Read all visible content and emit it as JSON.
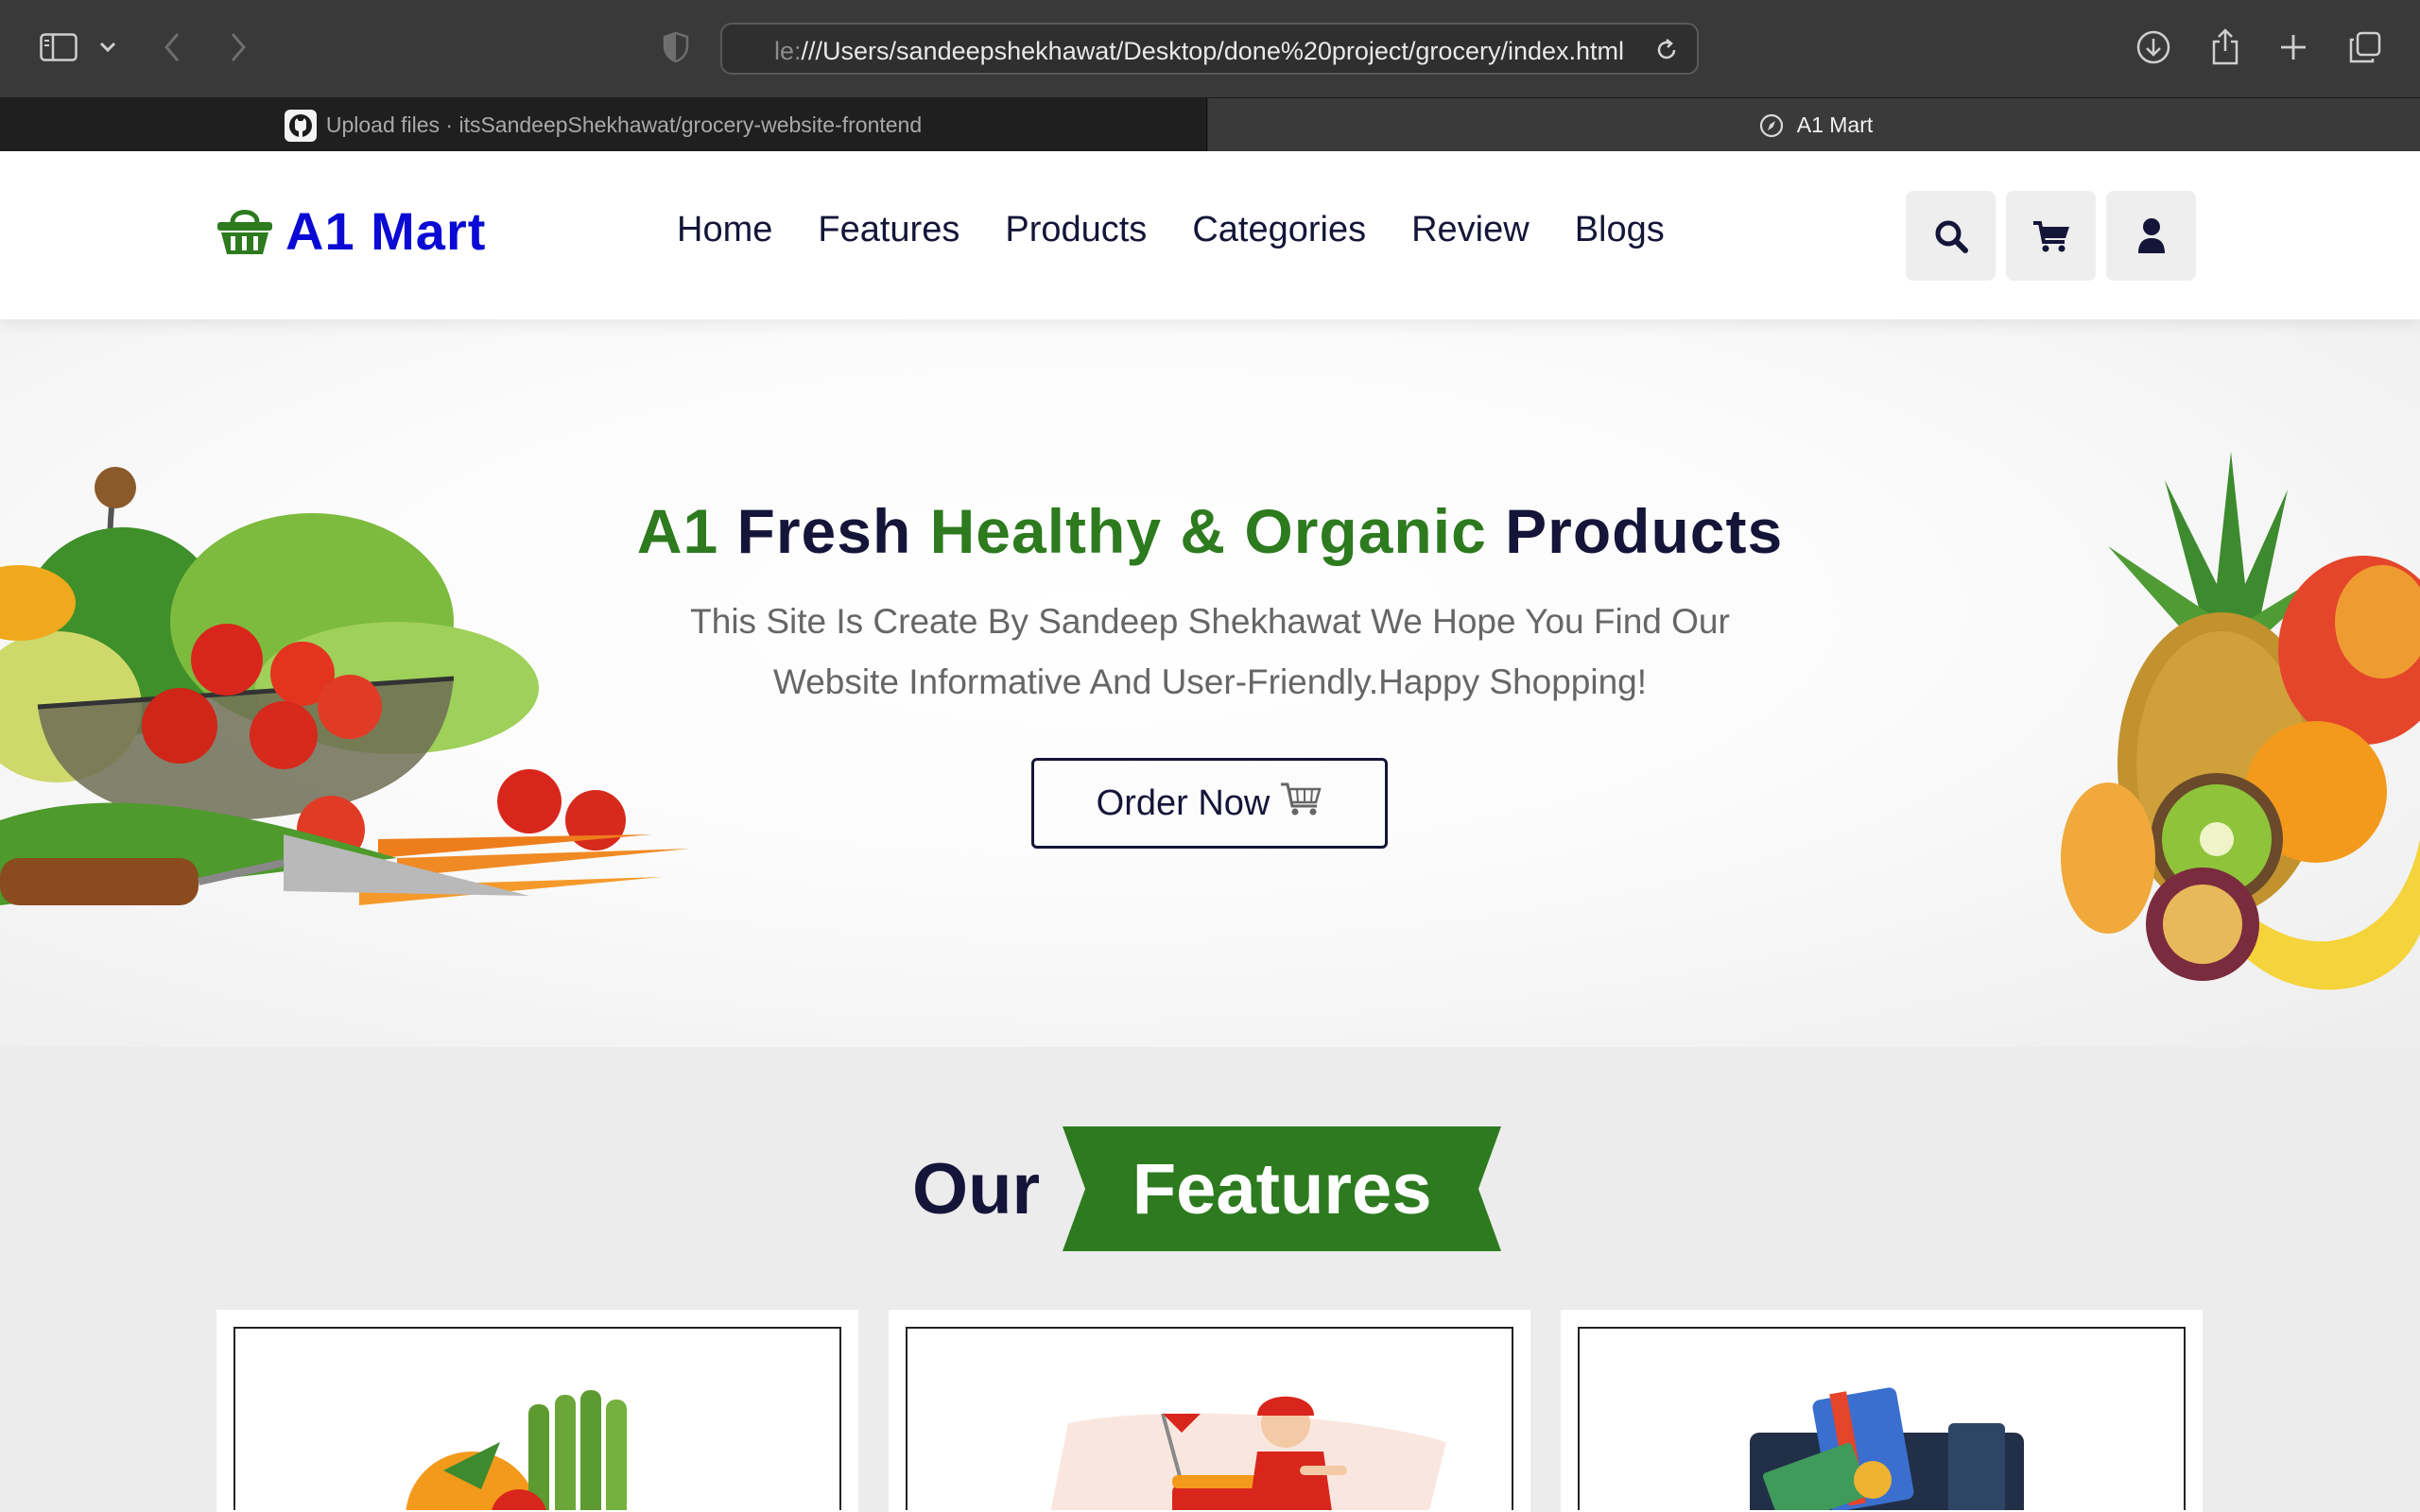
{
  "browser": {
    "url_prefix": "le:",
    "url_main": "///Users/sandeepshekhawat/Desktop/done%20project/grocery/index.html",
    "tabs": [
      {
        "title": "Upload files · itsSandeepShekhawat/grocery-website-frontend",
        "icon": "github-icon",
        "active": false
      },
      {
        "title": "A1 Mart",
        "icon": "compass-icon",
        "active": true
      }
    ]
  },
  "site": {
    "logo": "A1 Mart",
    "nav": [
      "Home",
      "Features",
      "Products",
      "Categories",
      "Review",
      "Blogs"
    ],
    "icons": [
      "search-icon",
      "cart-icon",
      "user-icon"
    ]
  },
  "hero": {
    "title_part1": "A1",
    "title_part2": "Fresh",
    "title_part3": "Healthy & Organic",
    "title_part4": "Products",
    "desc_line1": "This Site Is Create By Sandeep Shekhawat We Hope You Find Our",
    "desc_line2": "Website Informative And User-Friendly.Happy Shopping!",
    "cta": "Order Now"
  },
  "features": {
    "heading_our": "Our",
    "heading_features": "Features"
  },
  "colors": {
    "brand_green": "#2d7a1f",
    "brand_dark": "#151539",
    "logo_blue": "#0a0ad4"
  }
}
